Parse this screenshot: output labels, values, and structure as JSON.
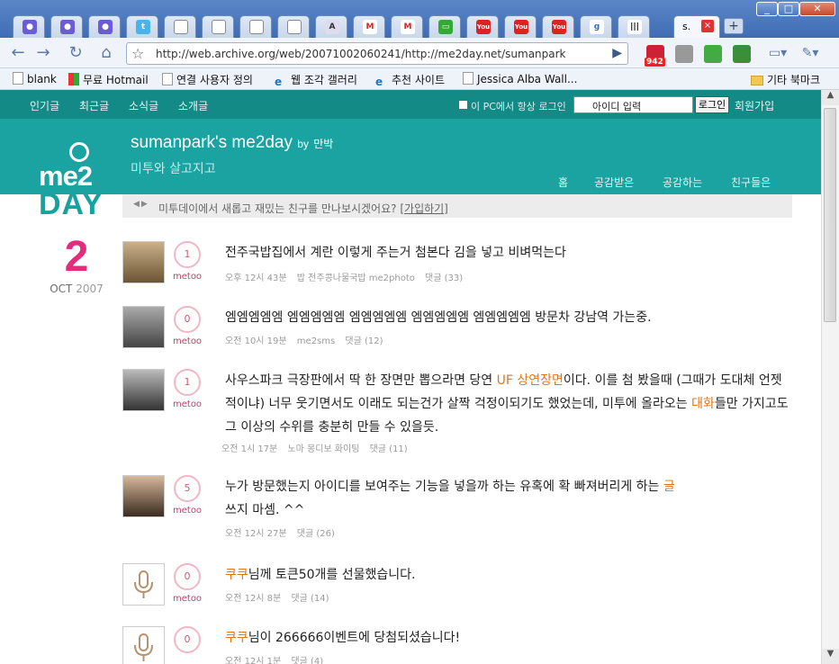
{
  "browser": {
    "url": "http://web.archive.org/web/20071002060241/http://me2day.net/sumanpark",
    "active_tab_title": "s.",
    "ext_badge": "942",
    "bookmarks": [
      {
        "label": "blank",
        "icon": "page-icon"
      },
      {
        "label": "무료 Hotmail",
        "icon": "windows-icon"
      },
      {
        "label": "연결 사용자 정의",
        "icon": "page-icon"
      },
      {
        "label": "웹 조각 갤러리",
        "icon": "ie-icon"
      },
      {
        "label": "추천 사이트",
        "icon": "ie-icon"
      },
      {
        "label": "Jessica Alba Wall...",
        "icon": "page-icon"
      }
    ],
    "other_bookmarks": "기타 북마크"
  },
  "topnav": {
    "links": [
      "인기글",
      "최근글",
      "소식글",
      "소개글"
    ],
    "remember": "이 PC에서 항상 로그인",
    "id_placeholder": "아이디 입력",
    "login": "로그인",
    "join": "회원가입"
  },
  "header": {
    "owner": "sumanpark's me2day",
    "by": "by",
    "nickname": "만박",
    "description": "미투와 살고지고",
    "nav": [
      "홈",
      "공감받은",
      "공감하는",
      "친구들은"
    ]
  },
  "logo": {
    "line1": "me2",
    "line2": "DAY"
  },
  "promo": {
    "text": "미투데이에서 새롭고 재밌는 친구를 만나보시겠어요?",
    "link": "[가입하기]"
  },
  "date": {
    "day": "2",
    "month": "OCT",
    "year": "2007"
  },
  "metoo_label": "metoo",
  "posts": [
    {
      "metoo": "1",
      "text_html": "전주국밥집에서 계란 이렇게 주는거 첨본다 김을 넣고 비벼먹는다",
      "time": "오후 12시 43분",
      "source": "밥 전주콩나물국밥 me2photo",
      "comments": "댓글 (33)"
    },
    {
      "metoo": "0",
      "text_html": "엠엠엠엠엠 엠엠엠엠엠 엠엠엠엠엠 엠엠엠엠엠 엠엠엠엠엠 방문차 강남역 가는중.",
      "time": "오전 10시 19분",
      "source": "me2sms",
      "comments": "댓글 (12)"
    },
    {
      "metoo": "1",
      "text_pre": "사우스파크 극장판에서 딱 한 장면만 뽑으라면 당연 ",
      "tag1": "UF 상연장면",
      "text_mid": "이다. 이를 첨 봤을때 (그때가 도대체 언젯적이냐) 너무 웃기면서도 이래도 되는건가 살짝 걱정이되기도 했었는데, 미투에 올라오는 ",
      "tag2": "대화",
      "text_post": "들만 가지고도 그 이상의 수위를 충분히 만들 수 있을듯.",
      "time": "오전 1시 17분",
      "source": "노마 몽디보 화이팅",
      "comments": "댓글 (11)"
    },
    {
      "metoo": "5",
      "text_pre": "누가 방문했는지 아이디를 보여주는 기능을 넣을까 하는 유혹에 확 빠져버리게 하는 ",
      "tag1": "글",
      "text_post": "쓰지 마셈. ^^",
      "time": "오전 12시 27분",
      "source": "",
      "comments": "댓글 (26)"
    },
    {
      "metoo": "0",
      "tag1": "쿠쿠",
      "text_post": "님께 토큰50개를 선물했습니다.",
      "time": "오전 12시 8분",
      "source": "",
      "comments": "댓글 (14)"
    },
    {
      "metoo": "0",
      "tag1": "쿠쿠",
      "text_post": "님이 266666이벤트에 당첨되셨습니다!",
      "time": "오전 12시 1분",
      "source": "",
      "comments": "댓글 (4)"
    }
  ]
}
